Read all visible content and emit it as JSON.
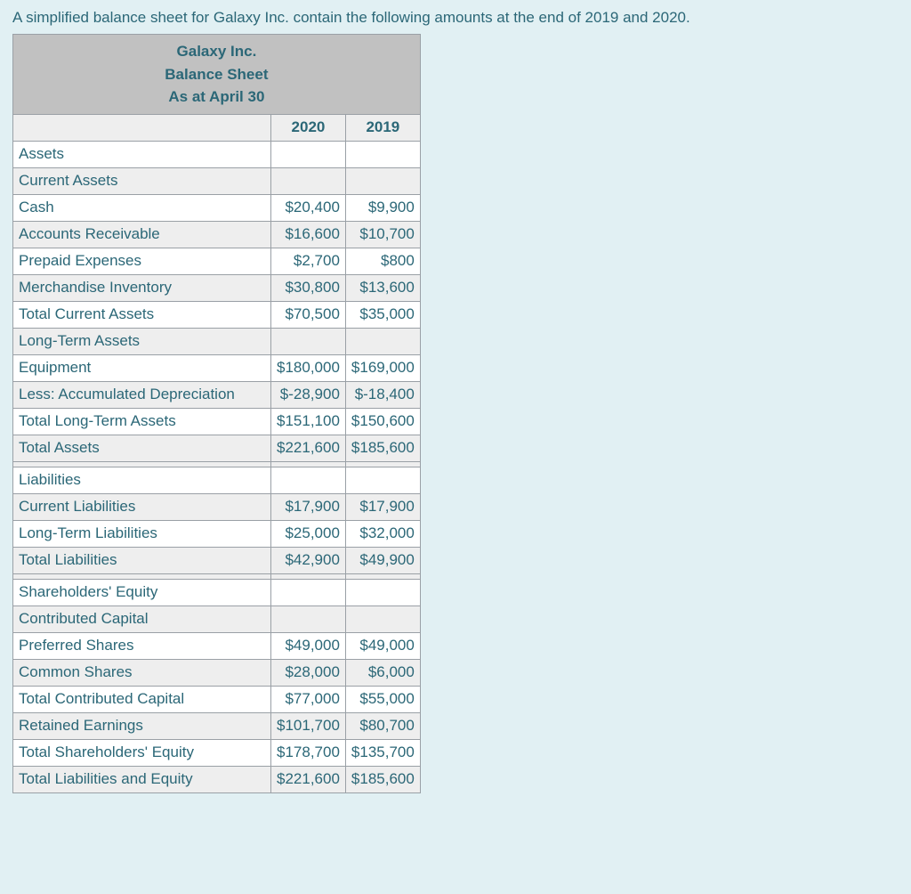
{
  "intro": "A simplified balance sheet for Galaxy Inc. contain the following amounts at the end of 2019 and 2020.",
  "header": {
    "company": "Galaxy Inc.",
    "statement": "Balance Sheet",
    "asat": "As at April 30"
  },
  "years": {
    "y1": "2020",
    "y2": "2019"
  },
  "rows": {
    "assets": {
      "label": "Assets",
      "y1": "",
      "y2": ""
    },
    "curAssets": {
      "label": "Current Assets",
      "y1": "",
      "y2": ""
    },
    "cash": {
      "label": "Cash",
      "y1": "$20,400",
      "y2": "$9,900"
    },
    "ar": {
      "label": "Accounts Receivable",
      "y1": "$16,600",
      "y2": "$10,700"
    },
    "prepaid": {
      "label": "Prepaid Expenses",
      "y1": "$2,700",
      "y2": "$800"
    },
    "merch": {
      "label": "Merchandise Inventory",
      "y1": "$30,800",
      "y2": "$13,600"
    },
    "totCurAssets": {
      "label": "Total Current Assets",
      "y1": "$70,500",
      "y2": "$35,000"
    },
    "ltAssets": {
      "label": "Long-Term Assets",
      "y1": "",
      "y2": ""
    },
    "equip": {
      "label": "Equipment",
      "y1": "$180,000",
      "y2": "$169,000"
    },
    "accDep": {
      "label": "Less: Accumulated Depreciation",
      "y1": "$-28,900",
      "y2": "$-18,400"
    },
    "totLtAssets": {
      "label": "Total Long-Term Assets",
      "y1": "$151,100",
      "y2": "$150,600"
    },
    "totAssets": {
      "label": "Total Assets",
      "y1": "$221,600",
      "y2": "$185,600"
    },
    "liab": {
      "label": "Liabilities",
      "y1": "",
      "y2": ""
    },
    "curLiab": {
      "label": "Current Liabilities",
      "y1": "$17,900",
      "y2": "$17,900"
    },
    "ltLiab": {
      "label": "Long-Term Liabilities",
      "y1": "$25,000",
      "y2": "$32,000"
    },
    "totLiab": {
      "label": "Total Liabilities",
      "y1": "$42,900",
      "y2": "$49,900"
    },
    "shEq": {
      "label": "Shareholders' Equity",
      "y1": "",
      "y2": ""
    },
    "contCap": {
      "label": "Contributed Capital",
      "y1": "",
      "y2": ""
    },
    "pref": {
      "label": "Preferred Shares",
      "y1": "$49,000",
      "y2": "$49,000"
    },
    "common": {
      "label": "Common Shares",
      "y1": "$28,000",
      "y2": "$6,000"
    },
    "totContCap": {
      "label": "Total Contributed Capital",
      "y1": "$77,000",
      "y2": "$55,000"
    },
    "re": {
      "label": "Retained Earnings",
      "y1": "$101,700",
      "y2": "$80,700"
    },
    "totShEq": {
      "label": "Total Shareholders' Equity",
      "y1": "$178,700",
      "y2": "$135,700"
    },
    "totLiabEq": {
      "label": "Total Liabilities and Equity",
      "y1": "$221,600",
      "y2": "$185,600"
    }
  }
}
